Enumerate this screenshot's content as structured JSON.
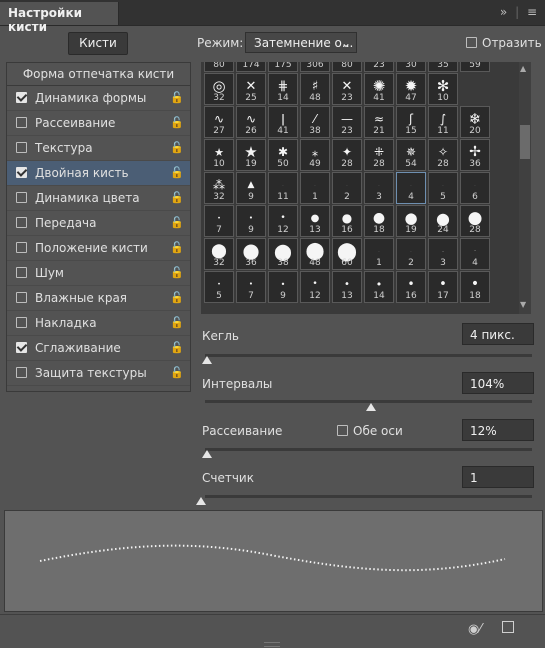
{
  "panel": {
    "title": "Настройки кисти",
    "menu_icon": "panel-menu-icon",
    "collapse_icon": "double-chevron-right-icon"
  },
  "toolbar": {
    "brushes_label": "Кисти",
    "mode_label": "Режим:",
    "mode_value": "Затемнение о...",
    "flip_label": "Отразить",
    "flip_checked": false
  },
  "left_list": {
    "header": "Форма отпечатка кисти",
    "items": [
      {
        "label": "Динамика формы",
        "checked": true,
        "selected": false
      },
      {
        "label": "Рассеивание",
        "checked": false,
        "selected": false
      },
      {
        "label": "Текстура",
        "checked": false,
        "selected": false
      },
      {
        "label": "Двойная кисть",
        "checked": true,
        "selected": true
      },
      {
        "label": "Динамика цвета",
        "checked": false,
        "selected": false
      },
      {
        "label": "Передача",
        "checked": false,
        "selected": false
      },
      {
        "label": "Положение кисти",
        "checked": false,
        "selected": false
      },
      {
        "label": "Шум",
        "checked": false,
        "selected": false
      },
      {
        "label": "Влажные края",
        "checked": false,
        "selected": false
      },
      {
        "label": "Накладка",
        "checked": false,
        "selected": false
      },
      {
        "label": "Сглаживание",
        "checked": true,
        "selected": false
      },
      {
        "label": "Защита текстуры",
        "checked": false,
        "selected": false
      }
    ]
  },
  "brush_grid": {
    "rows": [
      [
        "80",
        "174",
        "175",
        "306",
        "80",
        "23",
        "30",
        "35",
        "59"
      ],
      [
        "32",
        "25",
        "14",
        "48",
        "23",
        "41",
        "47",
        "10"
      ],
      [
        "27",
        "26",
        "41",
        "38",
        "23",
        "21",
        "15",
        "11",
        "20"
      ],
      [
        "10",
        "19",
        "50",
        "49",
        "28",
        "28",
        "54",
        "28",
        "36"
      ],
      [
        "32",
        "9",
        "11",
        "1",
        "2",
        "3",
        "4",
        "5",
        "6"
      ],
      [
        "7",
        "9",
        "12",
        "13",
        "16",
        "18",
        "19",
        "24",
        "28"
      ],
      [
        "32",
        "36",
        "38",
        "48",
        "60",
        "1",
        "2",
        "3",
        "4"
      ],
      [
        "5",
        "7",
        "9",
        "12",
        "13",
        "14",
        "16",
        "17",
        "18"
      ]
    ],
    "selected": "4"
  },
  "controls": {
    "size_label": "Кегль",
    "size_value": "4 пикс.",
    "spacing_label": "Интервалы",
    "spacing_value": "104%",
    "scatter_label": "Рассеивание",
    "both_axes_label": "Обе оси",
    "scatter_value": "12%",
    "count_label": "Счетчик",
    "count_value": "1"
  },
  "footer": {
    "icons": [
      "visibility-toggle-icon",
      "new-preset-icon"
    ]
  }
}
